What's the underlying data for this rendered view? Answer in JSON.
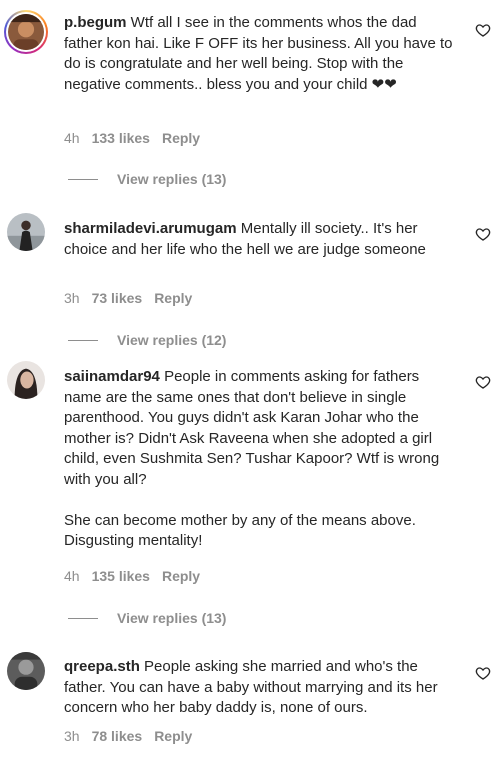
{
  "comments": [
    {
      "username": "p.begum",
      "text": "Wtf all I see in the comments whos the dad father kon hai. Like F OFF its her business. All you have to do is congratulate and her well being. Stop with the negative comments.. bless you and your child ❤❤",
      "time": "4h",
      "likes": "133 likes",
      "reply_label": "Reply",
      "view_replies": "View replies (13)"
    },
    {
      "username": "sharmiladevi.arumugam",
      "text": "Mentally ill society.. It's her choice and her life who the hell we are judge someone",
      "time": "3h",
      "likes": "73 likes",
      "reply_label": "Reply",
      "view_replies": "View replies (12)"
    },
    {
      "username": "saiinamdar94",
      "text": "People in comments asking for fathers name are the same ones that don't believe in single parenthood. You guys didn't ask Karan Johar who the mother is? Didn't Ask Raveena when she adopted a girl child, even Sushmita Sen? Tushar Kapoor? Wtf is wrong with you all?\n\nShe can become mother by any of the means above. Disgusting mentality!",
      "time": "4h",
      "likes": "135 likes",
      "reply_label": "Reply",
      "view_replies": "View replies (13)"
    },
    {
      "username": "qreepa.sth",
      "text": "People asking she married and who's the father. You can have a baby without marrying and its her concern who her baby daddy is, none of ours.",
      "time": "3h",
      "likes": "78 likes",
      "reply_label": "Reply"
    }
  ],
  "icons": {
    "like": "heart-outline-icon"
  },
  "colors": {
    "text": "#262626",
    "secondary": "#8e8e8e"
  }
}
